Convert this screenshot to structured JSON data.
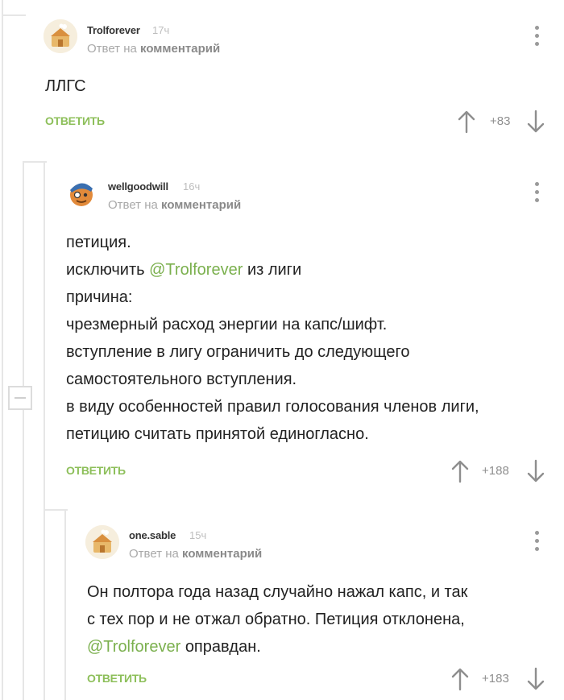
{
  "comments": [
    {
      "user": "Trolforever",
      "time": "17ч",
      "reply_prefix": "Ответ на",
      "reply_link": "комментарий",
      "lines": [
        "ЛЛГС"
      ],
      "answer_label": "ОТВЕТИТЬ",
      "score": "+83"
    },
    {
      "user": "wellgoodwill",
      "time": "16ч",
      "reply_prefix": "Ответ на",
      "reply_link": "комментарий",
      "lines": [
        "петиция.",
        "исключить",
        "@Trolforever",
        "из лиги",
        "причина:",
        "чрезмерный расход энергии на капс/шифт.",
        "вступление в лигу ограничить до следующего",
        "самостоятельного вступления.",
        "в виду особенностей правил голосования членов лиги,",
        "петицию считать принятой единогласно."
      ],
      "answer_label": "ОТВЕТИТЬ",
      "score": "+188"
    },
    {
      "user": "one.sable",
      "time": "15ч",
      "reply_prefix": "Ответ на",
      "reply_link": "комментарий",
      "lines": [
        "Он полтора года назад случайно нажал капс, и так",
        "с тех пор и не отжал обратно. Петиция отклонена,",
        "@Trolforever",
        "оправдан."
      ],
      "answer_label": "ОТВЕТИТЬ",
      "score": "+183"
    }
  ],
  "colors": {
    "accent_green": "#8dbf5a",
    "mention_green": "#7bb04e",
    "thread_line": "#e6e6e6"
  },
  "icons": {
    "upvote": "arrow-up-icon",
    "downvote": "arrow-down-icon",
    "menu": "kebab-menu-icon",
    "collapse": "minus-icon"
  }
}
